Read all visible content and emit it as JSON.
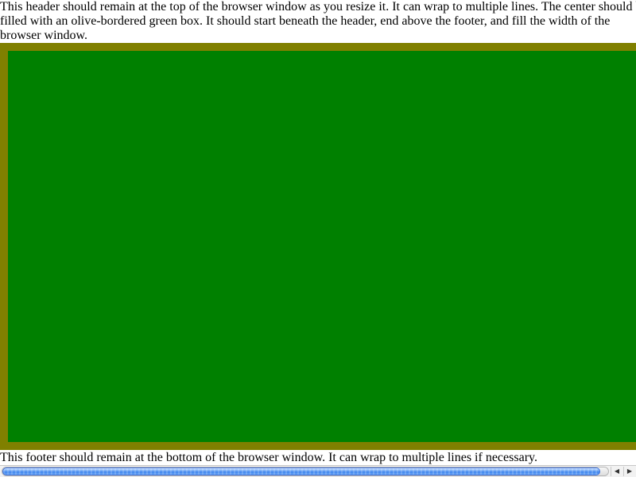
{
  "header": {
    "lines": [
      "This header should remain at the top of the browser window as you resize it. It can wrap to multiple lines. The center should be",
      "filled with an olive-bordered green box. It should start beneath the header, end above the footer, and fill the width of the",
      "browser window."
    ]
  },
  "box": {
    "fill_color": "#008000",
    "border_color": "#808000"
  },
  "footer": {
    "text": "This footer should remain at the bottom of the browser window. It can wrap to multiple lines if necessary."
  },
  "scrollbar": {
    "left_arrow": "◀",
    "right_arrow": "▶"
  }
}
